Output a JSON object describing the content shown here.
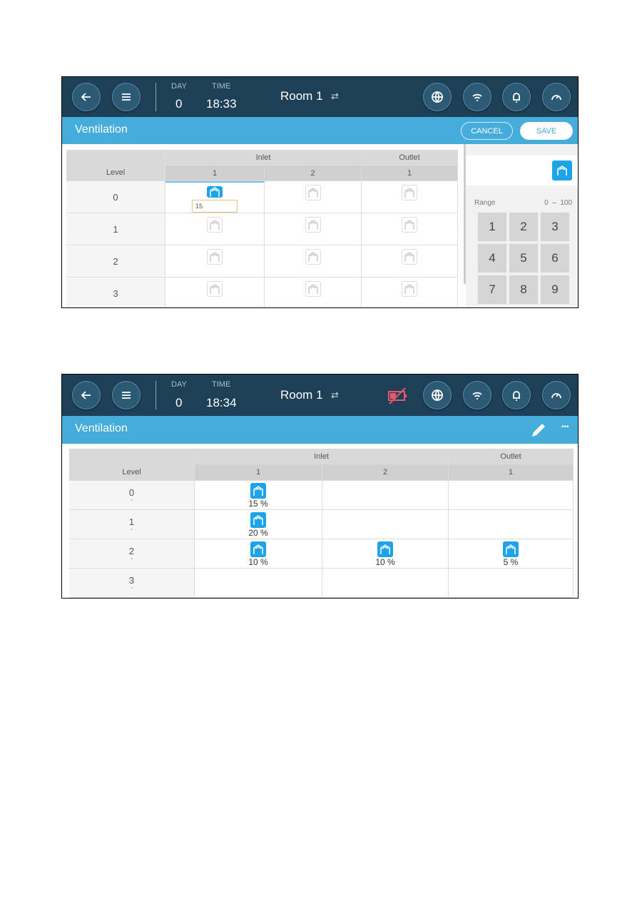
{
  "colors": {
    "header": "#1d4057",
    "titlebar": "#45acdc",
    "active_icon": "#1da3e8",
    "battery_alert": "#e8566a"
  },
  "screen1": {
    "day_label": "DAY",
    "day": "0",
    "time_label": "TIME",
    "time": "18:33",
    "room": "Room 1",
    "title": "Ventilation",
    "cancel": "CANCEL",
    "save": "SAVE",
    "table": {
      "level_header": "Level",
      "groups": [
        "Inlet",
        "Outlet"
      ],
      "columns": [
        "1",
        "2",
        "1"
      ],
      "rows": [
        {
          "level": "0",
          "active": [
            true,
            false,
            false
          ]
        },
        {
          "level": "1",
          "active": [
            false,
            false,
            false
          ]
        },
        {
          "level": "2",
          "active": [
            false,
            false,
            false
          ]
        },
        {
          "level": "3",
          "active": [
            false,
            false,
            false
          ]
        }
      ]
    },
    "edit_value": "15",
    "range_label": "Range",
    "range_value": "0  –  100",
    "keypad": [
      "1",
      "2",
      "3",
      "4",
      "5",
      "6",
      "7",
      "8",
      "9"
    ]
  },
  "screen2": {
    "day_label": "DAY",
    "day": "0",
    "time_label": "TIME",
    "time": "18:34",
    "room": "Room 1",
    "title": "Ventilation",
    "more": "•••",
    "table": {
      "level_header": "Level",
      "groups": [
        "Inlet",
        "Outlet"
      ],
      "columns": [
        "1",
        "2",
        "1"
      ],
      "rows": [
        {
          "level": "0",
          "values": [
            "15 %",
            "",
            ""
          ]
        },
        {
          "level": "1",
          "values": [
            "20 %",
            "",
            ""
          ]
        },
        {
          "level": "2",
          "values": [
            "10 %",
            "10 %",
            "5 %"
          ]
        },
        {
          "level": "3",
          "values": [
            "",
            "",
            ""
          ]
        }
      ]
    }
  }
}
